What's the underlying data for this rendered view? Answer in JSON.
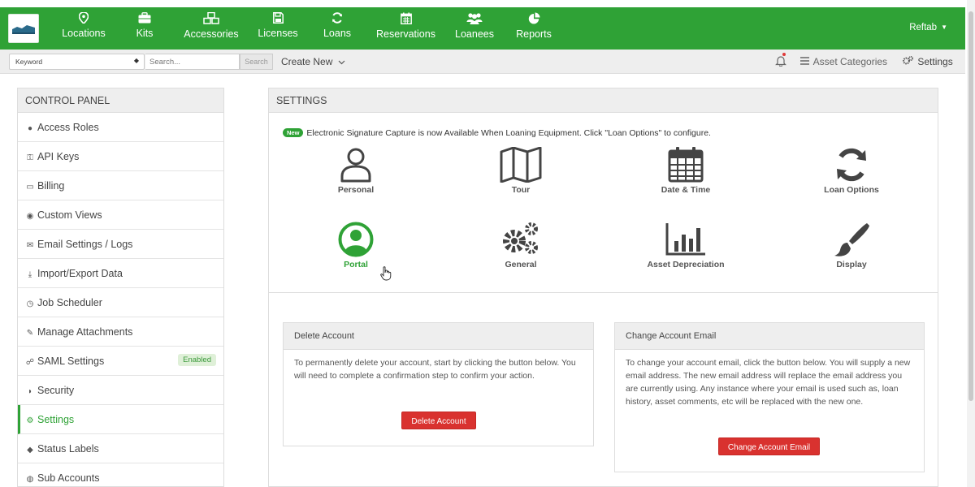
{
  "nav": {
    "items": [
      {
        "label": "Locations",
        "icon": "map-pin-icon"
      },
      {
        "label": "Kits",
        "icon": "briefcase-icon"
      },
      {
        "label": "Accessories",
        "icon": "cubes-icon"
      },
      {
        "label": "Licenses",
        "icon": "floppy-disk-icon"
      },
      {
        "label": "Loans",
        "icon": "refresh-icon"
      },
      {
        "label": "Reservations",
        "icon": "calendar-icon"
      },
      {
        "label": "Loanees",
        "icon": "users-icon"
      },
      {
        "label": "Reports",
        "icon": "pie-chart-icon"
      }
    ],
    "user": "Reftab",
    "color": "#2fa236"
  },
  "subbar": {
    "keyword": "Keyword",
    "search_placeholder": "Search...",
    "search_button": "Search",
    "create_new": "Create New",
    "asset_categories": "Asset Categories",
    "settings": "Settings"
  },
  "sidebar": {
    "title": "CONTROL PANEL",
    "items": [
      {
        "label": "Access Roles",
        "glyph": "●"
      },
      {
        "label": "API Keys",
        "glyph": "⚿"
      },
      {
        "label": "Billing",
        "glyph": "▭"
      },
      {
        "label": "Custom Views",
        "glyph": "◉"
      },
      {
        "label": "Email Settings / Logs",
        "glyph": "✉"
      },
      {
        "label": "Import/Export Data",
        "glyph": "⤓"
      },
      {
        "label": "Job Scheduler",
        "glyph": "◷"
      },
      {
        "label": "Manage Attachments",
        "glyph": "✎"
      },
      {
        "label": "SAML Settings",
        "glyph": "☍"
      },
      {
        "label": "Security",
        "glyph": "◗"
      },
      {
        "label": "Settings",
        "glyph": "⚙"
      },
      {
        "label": "Status Labels",
        "glyph": "◆"
      },
      {
        "label": "Sub Accounts",
        "glyph": "◍"
      }
    ],
    "saml_badge": "Enabled",
    "active_index": 10
  },
  "settings_panel": {
    "title": "SETTINGS",
    "notice_badge": "New",
    "notice_text": "Electronic Signature Capture is now Available When Loaning Equipment. Click \"Loan Options\" to configure.",
    "tiles": [
      {
        "label": "Personal",
        "icon": "user-icon"
      },
      {
        "label": "Tour",
        "icon": "map-icon"
      },
      {
        "label": "Date & Time",
        "icon": "calendar-icon"
      },
      {
        "label": "Loan Options",
        "icon": "refresh-icon"
      },
      {
        "label": "Portal",
        "icon": "user-circle-icon"
      },
      {
        "label": "General",
        "icon": "gears-icon"
      },
      {
        "label": "Asset Depreciation",
        "icon": "bar-chart-icon"
      },
      {
        "label": "Display",
        "icon": "paintbrush-icon"
      }
    ],
    "active_tile": "Portal"
  },
  "delete_account": {
    "title": "Delete Account",
    "text": "To permanently delete your account, start by clicking the button below. You will need to complete a confirmation step to confirm your action.",
    "button": "Delete Account"
  },
  "change_email": {
    "title": "Change Account Email",
    "text": "To change your account email, click the button below. You will supply a new email address. The new email address will replace the email address you are currently using. Any instance where your email is used such as, loan history, asset comments, etc will be replaced with the new one.",
    "button": "Change Account Email"
  },
  "colors": {
    "accent": "#2fa236",
    "danger": "#d9322f"
  }
}
